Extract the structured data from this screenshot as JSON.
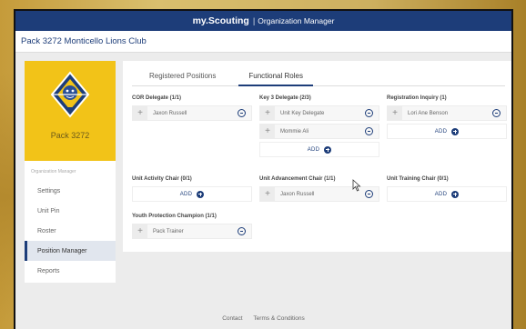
{
  "app": {
    "brand": "my.Scouting",
    "separator": "|",
    "module": "Organization Manager"
  },
  "page": {
    "title": "Pack 3272 Monticello Lions Club"
  },
  "sidebar": {
    "unit_name": "Pack 3272",
    "caption": "Organization Manager",
    "items": [
      {
        "label": "Settings"
      },
      {
        "label": "Unit Pin"
      },
      {
        "label": "Roster"
      },
      {
        "label": "Position Manager"
      },
      {
        "label": "Reports"
      }
    ]
  },
  "tabs": [
    {
      "label": "Registered Positions"
    },
    {
      "label": "Functional Roles"
    }
  ],
  "roles": {
    "cor_delegate": {
      "title": "COR Delegate (1/1)",
      "assignees": [
        "Jaxon Russell"
      ]
    },
    "key3_delegate": {
      "title": "Key 3 Delegate (2/3)",
      "assignees": [
        "Unit Key Delegate",
        "Mommie Ali"
      ],
      "add_label": "ADD"
    },
    "registration_inquiry": {
      "title": "Registration Inquiry (1)",
      "assignees": [
        "Lori Ane Benson"
      ],
      "add_label": "ADD"
    },
    "unit_activity_chair": {
      "title": "Unit Activity Chair (0/1)",
      "add_label": "ADD"
    },
    "unit_advancement_chair": {
      "title": "Unit Advancement Chair (1/1)",
      "assignees": [
        "Jaxon Russell"
      ]
    },
    "unit_training_chair": {
      "title": "Unit Training Chair (0/1)",
      "add_label": "ADD"
    },
    "youth_protection_champion": {
      "title": "Youth Protection Champion (1/1)",
      "assignees": [
        "Pack Trainer"
      ]
    }
  },
  "footer": {
    "contact": "Contact",
    "terms": "Terms & Conditions"
  },
  "colors": {
    "primary": "#1d3d79",
    "unit_card": "#f2c318",
    "background": "#ececec"
  }
}
